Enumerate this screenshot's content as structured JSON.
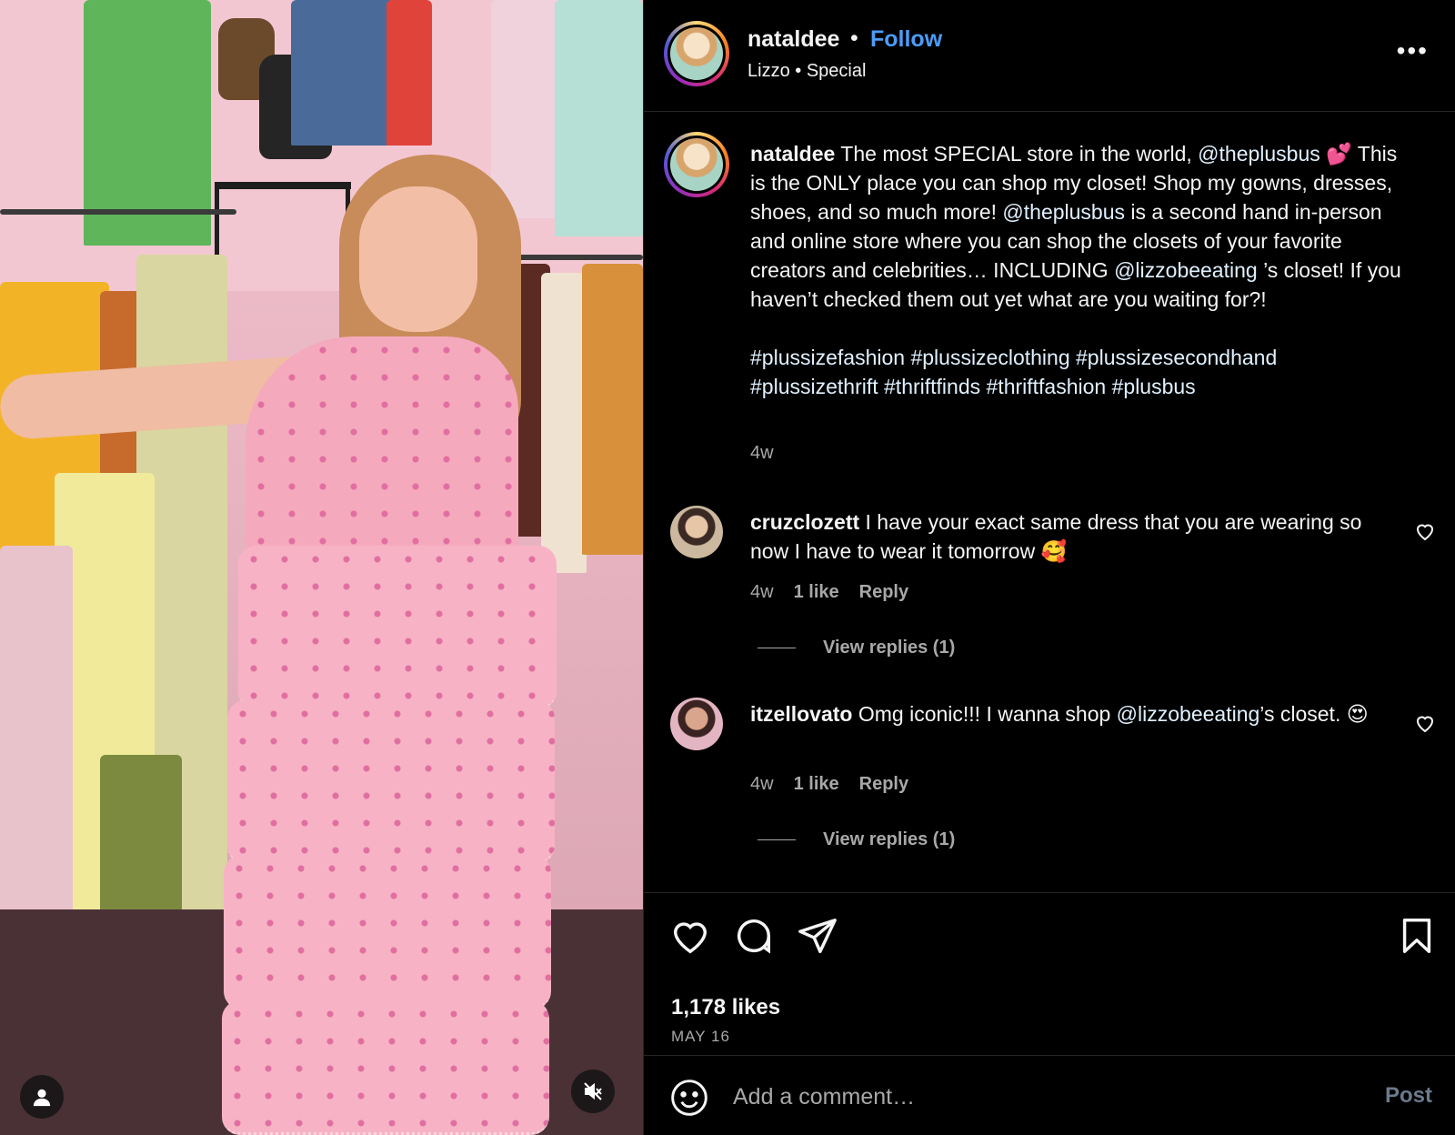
{
  "post": {
    "username": "nataldee",
    "follow_label": "Follow",
    "audio_artist": "Lizzo",
    "audio_track": "Special",
    "separator": "•",
    "more_label": "•••"
  },
  "caption": {
    "username": "nataldee",
    "parts": [
      {
        "text": " The most SPECIAL store in the world, "
      },
      {
        "text": "@theplusbus",
        "type": "mention"
      },
      {
        "text": " 💕 This is the ONLY place you can shop my closet! Shop my gowns, dresses, shoes, and so much more! "
      },
      {
        "text": "@theplusbus",
        "type": "mention"
      },
      {
        "text": " is a second hand in-person and online store where you can shop the closets of your favorite creators and celebrities… INCLUDING "
      },
      {
        "text": "@lizzobeeating",
        "type": "mention"
      },
      {
        "text": " ’s closet! If you haven’t checked them out yet what are you waiting for?!"
      }
    ],
    "hashtags": [
      "#plussizefashion",
      "#plussizeclothing",
      "#plussizesecondhand",
      "#plussizethrift",
      "#thriftfinds",
      "#thriftfashion",
      "#plusbus"
    ],
    "time": "4w"
  },
  "comments": [
    {
      "username": "cruzclozett",
      "text": " I have your exact same dress that you are wearing so now I have to wear it tomorrow 🥰",
      "time": "4w",
      "likes": "1 like",
      "reply_label": "Reply",
      "view_replies": "View replies (1)"
    },
    {
      "username": "itzellovato",
      "text_before": " Omg iconic!!! I wanna shop ",
      "mention": "@lizzobeeating",
      "text_after": "’s closet. 😍",
      "time": "4w",
      "likes": "1 like",
      "reply_label": "Reply",
      "view_replies": "View replies (1)"
    }
  ],
  "stats": {
    "likes": "1,178 likes",
    "date": "MAY 16"
  },
  "composer": {
    "placeholder": "Add a comment…",
    "post_label": "Post"
  },
  "colors": {
    "accent_link": "#4a9df8",
    "background": "#000000",
    "muted_text": "#a8a8a8"
  }
}
